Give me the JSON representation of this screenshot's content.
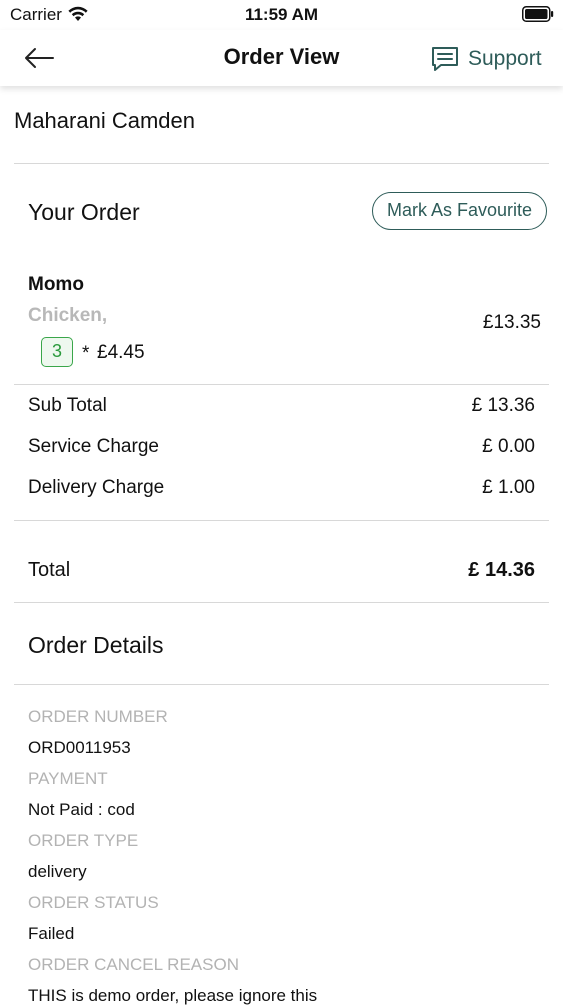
{
  "status_bar": {
    "carrier": "Carrier",
    "time": "11:59 AM"
  },
  "nav": {
    "title": "Order View",
    "support_label": "Support",
    "accent_color": "#2e5c59"
  },
  "restaurant": {
    "name": "Maharani Camden"
  },
  "order": {
    "heading": "Your Order",
    "favourite_label": "Mark As Favourite",
    "items": [
      {
        "name": "Momo",
        "option": "Chicken,",
        "quantity": "3",
        "times": "*",
        "unit_price": "£4.45",
        "line_price": "£13.35"
      }
    ]
  },
  "summary": {
    "rows": [
      {
        "label": "Sub Total",
        "value": "£ 13.36"
      },
      {
        "label": "Service Charge",
        "value": "£ 0.00"
      },
      {
        "label": "Delivery Charge",
        "value": "£ 1.00"
      }
    ],
    "total_label": "Total",
    "total_value": "£ 14.36"
  },
  "details": {
    "heading": "Order Details",
    "fields": [
      {
        "label": "ORDER NUMBER",
        "value": "ORD0011953"
      },
      {
        "label": "PAYMENT",
        "value": "Not Paid : cod"
      },
      {
        "label": "ORDER TYPE",
        "value": "delivery"
      },
      {
        "label": "ORDER STATUS",
        "value": "Failed"
      },
      {
        "label": "ORDER CANCEL REASON",
        "value": "THIS is demo order, please ignore this"
      }
    ]
  }
}
